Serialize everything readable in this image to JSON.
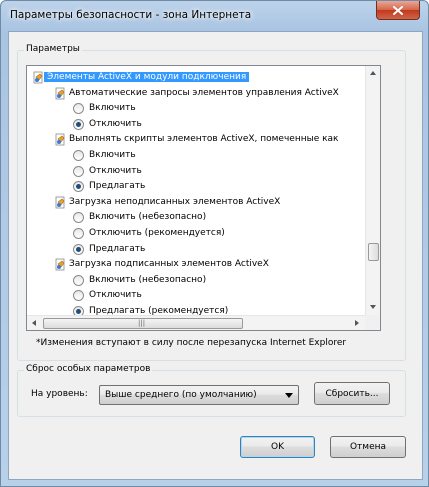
{
  "window": {
    "title": "Параметры безопасности - зона Интернета",
    "close_icon": "close-icon"
  },
  "settings_group": {
    "legend": "Параметры",
    "tree": [
      {
        "kind": "category",
        "label": "Элементы ActiveX и модули подключения",
        "selected": true
      },
      {
        "kind": "setting",
        "label": "Автоматические запросы элементов управления ActiveX"
      },
      {
        "kind": "option",
        "label": "Включить",
        "checked": false
      },
      {
        "kind": "option",
        "label": "Отключить",
        "checked": true
      },
      {
        "kind": "setting",
        "label": "Выполнять скрипты элементов ActiveX, помеченные как"
      },
      {
        "kind": "option",
        "label": "Включить",
        "checked": false
      },
      {
        "kind": "option",
        "label": "Отключить",
        "checked": false
      },
      {
        "kind": "option",
        "label": "Предлагать",
        "checked": true
      },
      {
        "kind": "setting",
        "label": "Загрузка неподписанных элементов ActiveX"
      },
      {
        "kind": "option",
        "label": "Включить (небезопасно)",
        "checked": false
      },
      {
        "kind": "option",
        "label": "Отключить (рекомендуется)",
        "checked": false
      },
      {
        "kind": "option",
        "label": "Предлагать",
        "checked": true
      },
      {
        "kind": "setting",
        "label": "Загрузка подписанных элементов ActiveX"
      },
      {
        "kind": "option",
        "label": "Включить (небезопасно)",
        "checked": false
      },
      {
        "kind": "option",
        "label": "Отключить",
        "checked": false
      },
      {
        "kind": "option",
        "label": "Предлагать (рекомендуется)",
        "checked": true
      }
    ],
    "note": "*Изменения вступают в силу после перезапуска Internet Explorer"
  },
  "reset_group": {
    "legend": "Сброс особых параметров",
    "level_label": "На уровень:",
    "level_value": "Выше среднего (по умолчанию)",
    "reset_button": "Сбросить..."
  },
  "buttons": {
    "ok": "OK",
    "cancel": "Отмена"
  },
  "colors": {
    "selection": "#3399ff",
    "close_button": "#c0391c",
    "title_bar": "#b9d0e9"
  }
}
